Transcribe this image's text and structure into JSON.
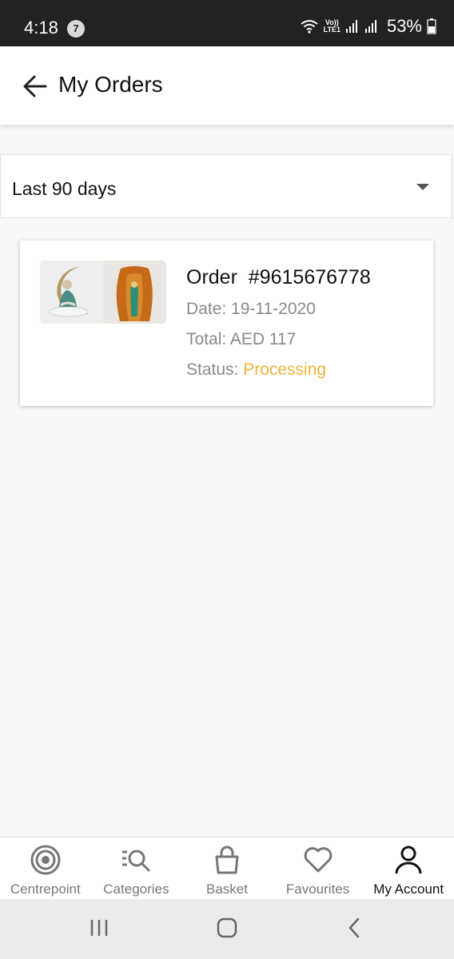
{
  "status_bar": {
    "time": "4:18",
    "notification_count": "7",
    "battery": "53%",
    "network_label_top": "Vo))",
    "network_label_bottom": "LTE1"
  },
  "header": {
    "title": "My Orders"
  },
  "filter": {
    "selected": "Last 90 days"
  },
  "orders": [
    {
      "order_label": "Order  #9615676778",
      "date_label": "Date: ",
      "date": "19-11-2020",
      "total_label": "Total: ",
      "total": "AED 117",
      "status_label": "Status: ",
      "status": "Processing",
      "status_color": "#f0b43a"
    }
  ],
  "bottom_nav": [
    {
      "label": "Centrepoint",
      "icon": "target-icon"
    },
    {
      "label": "Categories",
      "icon": "search-list-icon"
    },
    {
      "label": "Basket",
      "icon": "basket-icon"
    },
    {
      "label": "Favourites",
      "icon": "heart-icon"
    },
    {
      "label": "My Account",
      "icon": "user-icon",
      "active": true
    }
  ],
  "colors": {
    "accent_status": "#f0b43a",
    "status_bar_bg": "#222222"
  }
}
